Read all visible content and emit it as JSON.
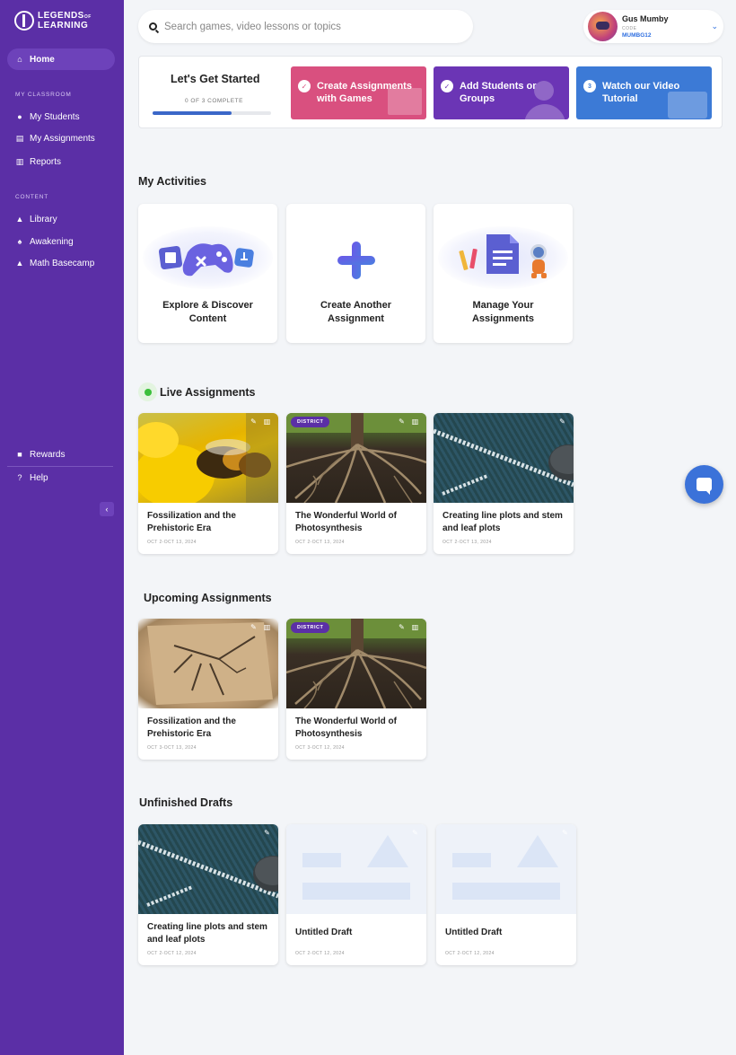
{
  "brand": {
    "line1": "LEGENDS",
    "line2": "LEARNING",
    "small": "OF"
  },
  "sidebar": {
    "home": "Home",
    "section_classroom": "MY CLASSROOM",
    "students": "My Students",
    "assignments": "My Assignments",
    "reports": "Reports",
    "section_content": "CONTENT",
    "library": "Library",
    "awakening": "Awakening",
    "basecamp": "Math Basecamp",
    "rewards": "Rewards",
    "help": "Help",
    "collapse": "‹"
  },
  "search": {
    "placeholder": "Search games, video lessons or topics"
  },
  "profile": {
    "name": "Gus Mumby",
    "code_label": "CODE",
    "code": "MUMBG12",
    "chevron": "⌄"
  },
  "getting_started": {
    "title": "Let's Get Started",
    "count": "0 OF 3 COMPLETE",
    "progress": 0.67,
    "steps": [
      {
        "label": "Create Assignments with Games",
        "mark": "✓",
        "color": "#d9507f"
      },
      {
        "label": "Add Students or Groups",
        "mark": "✓",
        "color": "#6b35b5"
      },
      {
        "label": "Watch our Video Tutorial",
        "mark": "3",
        "color": "#3c7ad6"
      }
    ]
  },
  "activities": {
    "title": "My Activities",
    "cards": [
      {
        "label": "Explore & Discover Content"
      },
      {
        "label": "Create Another Assignment"
      },
      {
        "label": "Manage Your Assignments"
      }
    ]
  },
  "live": {
    "title": "Live Assignments",
    "cards": [
      {
        "title": "Fossilization and the Prehistoric Era",
        "date": "OCT 2-OCT 13, 2024"
      },
      {
        "title": "The Wonderful World of Photosynthesis",
        "date": "OCT 2-OCT 13, 2024",
        "badge": "DISTRICT"
      },
      {
        "title": "Creating line plots and stem and leaf plots",
        "date": "OCT 2-OCT 13, 2024"
      }
    ]
  },
  "upcoming": {
    "title": "Upcoming Assignments",
    "cards": [
      {
        "title": "Fossilization and the Prehistoric Era",
        "date": "OCT 3-OCT 13, 2024"
      },
      {
        "title": "The Wonderful World of Photosynthesis",
        "date": "OCT 3-OCT 12, 2024",
        "badge": "DISTRICT"
      }
    ]
  },
  "drafts": {
    "title": "Unfinished Drafts",
    "cards": [
      {
        "title": "Creating line plots and stem and leaf plots",
        "date": "OCT 2-OCT 12, 2024"
      },
      {
        "title": "Untitled Draft",
        "date": "OCT 2-OCT 12, 2024"
      },
      {
        "title": "Untitled Draft",
        "date": "OCT 2-OCT 12, 2024"
      }
    ]
  },
  "icons": {
    "edit": "✎",
    "report": "▥"
  },
  "colors": {
    "sidebar": "#5b2fa6",
    "accent": "#3b72d9",
    "live": "#3bbf3b"
  }
}
